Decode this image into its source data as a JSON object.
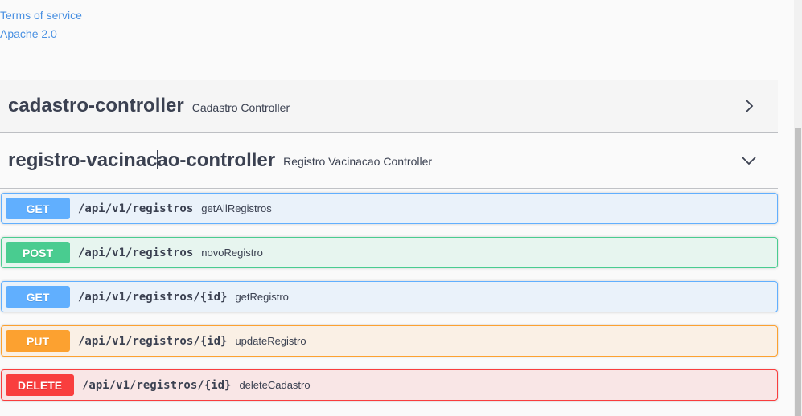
{
  "info": {
    "terms_link": "Terms of service",
    "license_link": "Apache 2.0"
  },
  "tags": [
    {
      "name_before_cursor": "cadastro-controller",
      "name_after_cursor": "",
      "description": "Cadastro Controller",
      "expanded": false,
      "chevron_icon": "chevron-right-icon"
    },
    {
      "name_before_cursor": "registro-vacinac",
      "name_after_cursor": "ao-controller",
      "description": "Registro Vacinacao Controller",
      "expanded": true,
      "chevron_icon": "chevron-down-icon"
    }
  ],
  "operations": [
    {
      "method": "GET",
      "path": "/api/v1/registros",
      "summary": "getAllRegistros",
      "color": "#61affe"
    },
    {
      "method": "POST",
      "path": "/api/v1/registros",
      "summary": "novoRegistro",
      "color": "#49cc90"
    },
    {
      "method": "GET",
      "path": "/api/v1/registros/{id}",
      "summary": "getRegistro",
      "color": "#61affe"
    },
    {
      "method": "PUT",
      "path": "/api/v1/registros/{id}",
      "summary": "updateRegistro",
      "color": "#fca130"
    },
    {
      "method": "DELETE",
      "path": "/api/v1/registros/{id}",
      "summary": "deleteCadastro",
      "color": "#f93e3e"
    }
  ]
}
